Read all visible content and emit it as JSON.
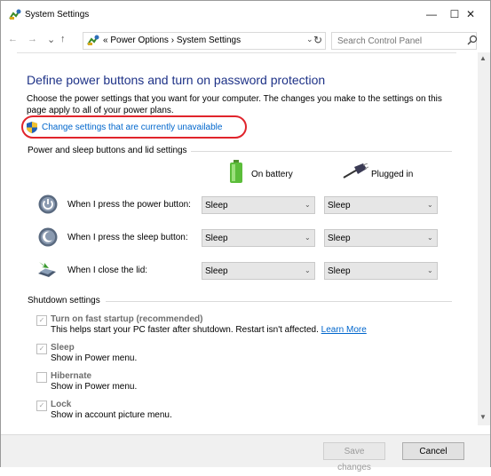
{
  "window": {
    "title": "System Settings",
    "controls": {
      "minimize": "—",
      "maximize": "☐",
      "close": "✕"
    }
  },
  "navbar": {
    "back": "←",
    "forward": "→",
    "recent": "⌄",
    "up": "↑",
    "breadcrumb_prefix": "«",
    "breadcrumbs": [
      "Power Options",
      "System Settings"
    ],
    "separator": "›",
    "dropdown": "⌄",
    "refresh": "↻",
    "search_placeholder": "Search Control Panel"
  },
  "page": {
    "title": "Define power buttons and turn on password protection",
    "description": "Choose the power settings that you want for your computer. The changes you make to the settings on this page apply to all of your power plans.",
    "change_link": "Change settings that are currently unavailable"
  },
  "power_section": {
    "label": "Power and sleep buttons and lid settings",
    "columns": {
      "battery": "On battery",
      "plugged": "Plugged in"
    },
    "rows": [
      {
        "label": "When I press the power button:",
        "battery": "Sleep",
        "plugged": "Sleep",
        "icon": "power-button-icon"
      },
      {
        "label": "When I press the sleep button:",
        "battery": "Sleep",
        "plugged": "Sleep",
        "icon": "sleep-button-icon"
      },
      {
        "label": "When I close the lid:",
        "battery": "Sleep",
        "plugged": "Sleep",
        "icon": "laptop-lid-icon"
      }
    ]
  },
  "shutdown_section": {
    "label": "Shutdown settings",
    "items": [
      {
        "title": "Turn on fast startup (recommended)",
        "desc": "This helps start your PC faster after shutdown. Restart isn't affected.",
        "link": "Learn More",
        "checked": true
      },
      {
        "title": "Sleep",
        "desc": "Show in Power menu.",
        "checked": true
      },
      {
        "title": "Hibernate",
        "desc": "Show in Power menu.",
        "checked": false
      },
      {
        "title": "Lock",
        "desc": "Show in account picture menu.",
        "checked": true
      }
    ]
  },
  "footer": {
    "save": "Save changes",
    "cancel": "Cancel"
  },
  "colors": {
    "title_blue": "#1e3287",
    "link_blue": "#0066cc",
    "highlight_red": "#e0242c"
  }
}
